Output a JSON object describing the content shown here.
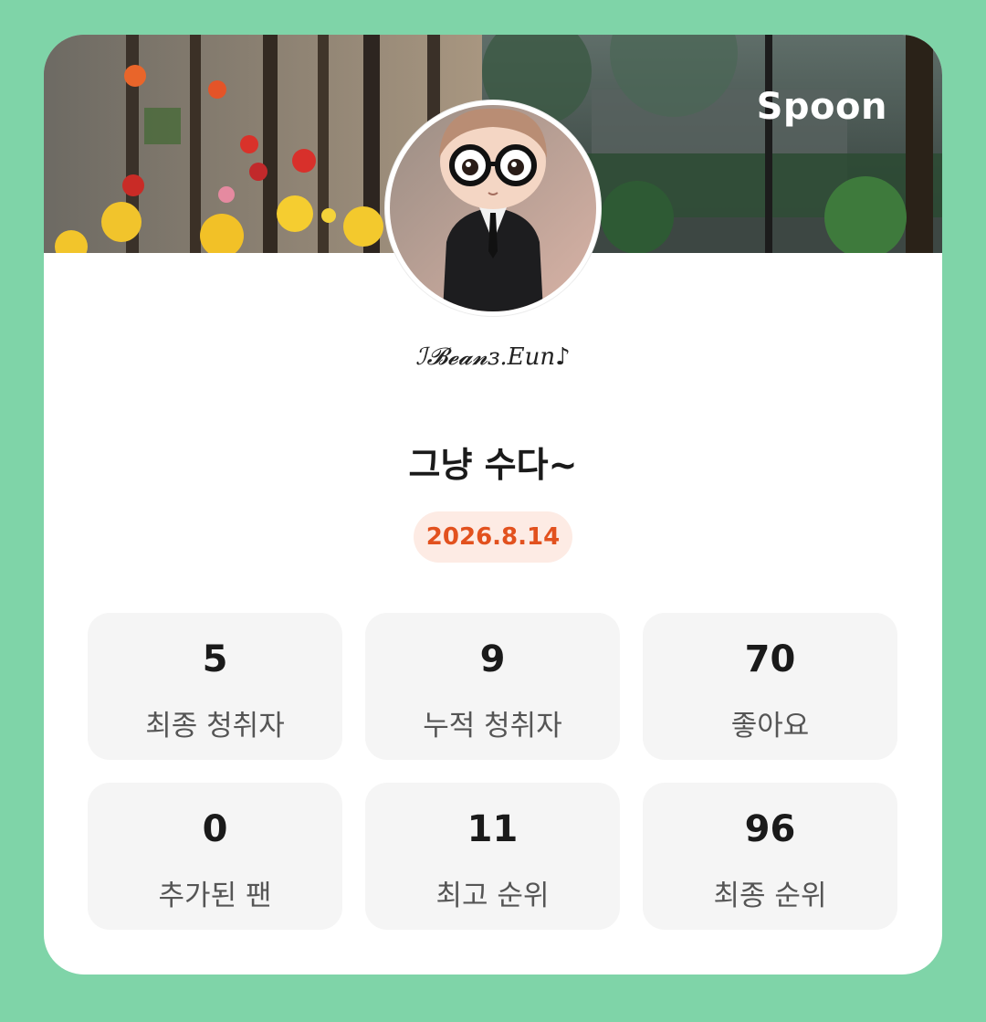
{
  "brand": "Spoon",
  "profile": {
    "username": "ℐ𝓑𝓮𝓪𝓷ɜ.Eun♪"
  },
  "broadcast": {
    "title": "그냥 수다~",
    "date": "2026.8.14"
  },
  "stats": [
    {
      "value": "5",
      "label": "최종 청취자"
    },
    {
      "value": "9",
      "label": "누적 청취자"
    },
    {
      "value": "70",
      "label": "좋아요"
    },
    {
      "value": "0",
      "label": "추가된 팬"
    },
    {
      "value": "11",
      "label": "최고 순위"
    },
    {
      "value": "96",
      "label": "최종 순위"
    }
  ],
  "colors": {
    "background": "#7fd4a8",
    "card": "#ffffff",
    "date_badge_bg": "#fdebe4",
    "date_badge_text": "#e2511e",
    "stat_tile_bg": "#f5f5f5"
  },
  "icons": {
    "avatar": "avatar-image",
    "banner": "banner-image"
  }
}
